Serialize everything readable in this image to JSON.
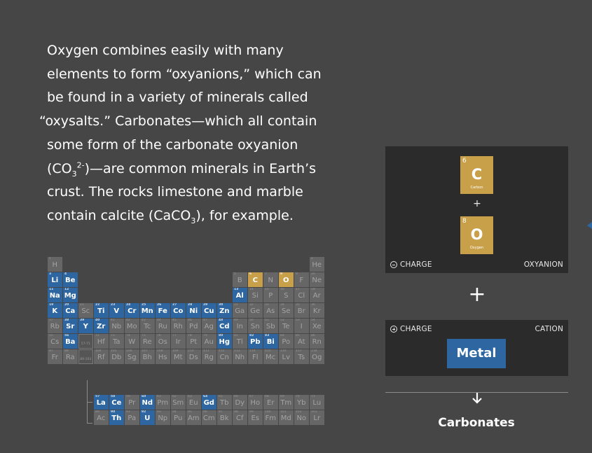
{
  "paragraph": {
    "l1": "Oxygen combines easily with many",
    "l2": "elements to form “oxyanions,” which can",
    "l3": "be found in a variety of minerals called",
    "l4": "“oxysalts.” Carbonates—which all contain",
    "l5": "some form of the carbonate oxyanion",
    "l6a": "(CO",
    "l6sub": "3",
    "l6sup": "2-",
    "l6b": ")—are common minerals in Earth’s",
    "l7": "crust. The rocks limestone and marble",
    "l8a": "contain calcite (CaCO",
    "l8sub": "3",
    "l8b": "), for example."
  },
  "periodic_table": {
    "elements": [
      {
        "n": 1,
        "s": "H",
        "r": 0,
        "c": 0,
        "t": "plain"
      },
      {
        "n": 2,
        "s": "He",
        "r": 0,
        "c": 17,
        "t": "plain"
      },
      {
        "n": 3,
        "s": "Li",
        "r": 1,
        "c": 0,
        "t": "high"
      },
      {
        "n": 4,
        "s": "Be",
        "r": 1,
        "c": 1,
        "t": "high"
      },
      {
        "n": 5,
        "s": "B",
        "r": 1,
        "c": 12,
        "t": "plain"
      },
      {
        "n": 6,
        "s": "C",
        "r": 1,
        "c": 13,
        "t": "gold"
      },
      {
        "n": 7,
        "s": "N",
        "r": 1,
        "c": 14,
        "t": "plain"
      },
      {
        "n": 8,
        "s": "O",
        "r": 1,
        "c": 15,
        "t": "gold"
      },
      {
        "n": 9,
        "s": "F",
        "r": 1,
        "c": 16,
        "t": "plain"
      },
      {
        "n": 10,
        "s": "Ne",
        "r": 1,
        "c": 17,
        "t": "plain"
      },
      {
        "n": 11,
        "s": "Na",
        "r": 2,
        "c": 0,
        "t": "high"
      },
      {
        "n": 12,
        "s": "Mg",
        "r": 2,
        "c": 1,
        "t": "high"
      },
      {
        "n": 13,
        "s": "Al",
        "r": 2,
        "c": 12,
        "t": "high"
      },
      {
        "n": 14,
        "s": "Si",
        "r": 2,
        "c": 13,
        "t": "plain"
      },
      {
        "n": 15,
        "s": "P",
        "r": 2,
        "c": 14,
        "t": "plain"
      },
      {
        "n": 16,
        "s": "S",
        "r": 2,
        "c": 15,
        "t": "plain"
      },
      {
        "n": 17,
        "s": "Cl",
        "r": 2,
        "c": 16,
        "t": "plain"
      },
      {
        "n": 18,
        "s": "Ar",
        "r": 2,
        "c": 17,
        "t": "plain"
      },
      {
        "n": 19,
        "s": "K",
        "r": 3,
        "c": 0,
        "t": "high"
      },
      {
        "n": 20,
        "s": "Ca",
        "r": 3,
        "c": 1,
        "t": "high"
      },
      {
        "n": 21,
        "s": "Sc",
        "r": 3,
        "c": 2,
        "t": "plain"
      },
      {
        "n": 22,
        "s": "Ti",
        "r": 3,
        "c": 3,
        "t": "high"
      },
      {
        "n": 23,
        "s": "V",
        "r": 3,
        "c": 4,
        "t": "high"
      },
      {
        "n": 24,
        "s": "Cr",
        "r": 3,
        "c": 5,
        "t": "high"
      },
      {
        "n": 25,
        "s": "Mn",
        "r": 3,
        "c": 6,
        "t": "high"
      },
      {
        "n": 26,
        "s": "Fe",
        "r": 3,
        "c": 7,
        "t": "high"
      },
      {
        "n": 27,
        "s": "Co",
        "r": 3,
        "c": 8,
        "t": "high"
      },
      {
        "n": 28,
        "s": "Ni",
        "r": 3,
        "c": 9,
        "t": "high"
      },
      {
        "n": 29,
        "s": "Cu",
        "r": 3,
        "c": 10,
        "t": "high"
      },
      {
        "n": 30,
        "s": "Zn",
        "r": 3,
        "c": 11,
        "t": "high"
      },
      {
        "n": 31,
        "s": "Ga",
        "r": 3,
        "c": 12,
        "t": "plain"
      },
      {
        "n": 32,
        "s": "Ge",
        "r": 3,
        "c": 13,
        "t": "plain"
      },
      {
        "n": 33,
        "s": "As",
        "r": 3,
        "c": 14,
        "t": "plain"
      },
      {
        "n": 34,
        "s": "Se",
        "r": 3,
        "c": 15,
        "t": "plain"
      },
      {
        "n": 35,
        "s": "Br",
        "r": 3,
        "c": 16,
        "t": "plain"
      },
      {
        "n": 36,
        "s": "Kr",
        "r": 3,
        "c": 17,
        "t": "plain"
      },
      {
        "n": 37,
        "s": "Rb",
        "r": 4,
        "c": 0,
        "t": "plain"
      },
      {
        "n": 38,
        "s": "Sr",
        "r": 4,
        "c": 1,
        "t": "high"
      },
      {
        "n": 39,
        "s": "Y",
        "r": 4,
        "c": 2,
        "t": "high"
      },
      {
        "n": 40,
        "s": "Zr",
        "r": 4,
        "c": 3,
        "t": "high"
      },
      {
        "n": 41,
        "s": "Nb",
        "r": 4,
        "c": 4,
        "t": "plain"
      },
      {
        "n": 42,
        "s": "Mo",
        "r": 4,
        "c": 5,
        "t": "plain"
      },
      {
        "n": 43,
        "s": "Tc",
        "r": 4,
        "c": 6,
        "t": "plain"
      },
      {
        "n": 44,
        "s": "Ru",
        "r": 4,
        "c": 7,
        "t": "plain"
      },
      {
        "n": 45,
        "s": "Rh",
        "r": 4,
        "c": 8,
        "t": "plain"
      },
      {
        "n": 46,
        "s": "Pd",
        "r": 4,
        "c": 9,
        "t": "plain"
      },
      {
        "n": 47,
        "s": "Ag",
        "r": 4,
        "c": 10,
        "t": "plain"
      },
      {
        "n": 48,
        "s": "Cd",
        "r": 4,
        "c": 11,
        "t": "high"
      },
      {
        "n": 49,
        "s": "In",
        "r": 4,
        "c": 12,
        "t": "plain"
      },
      {
        "n": 50,
        "s": "Sn",
        "r": 4,
        "c": 13,
        "t": "plain"
      },
      {
        "n": 51,
        "s": "Sb",
        "r": 4,
        "c": 14,
        "t": "plain"
      },
      {
        "n": 52,
        "s": "Te",
        "r": 4,
        "c": 15,
        "t": "plain"
      },
      {
        "n": 53,
        "s": "I",
        "r": 4,
        "c": 16,
        "t": "plain"
      },
      {
        "n": 54,
        "s": "Xe",
        "r": 4,
        "c": 17,
        "t": "plain"
      },
      {
        "n": 55,
        "s": "Cs",
        "r": 5,
        "c": 0,
        "t": "plain"
      },
      {
        "n": 56,
        "s": "Ba",
        "r": 5,
        "c": 1,
        "t": "high"
      },
      {
        "n": "",
        "s": "57-71",
        "r": 5,
        "c": 2,
        "t": "ph"
      },
      {
        "n": 72,
        "s": "Hf",
        "r": 5,
        "c": 3,
        "t": "plain"
      },
      {
        "n": 73,
        "s": "Ta",
        "r": 5,
        "c": 4,
        "t": "plain"
      },
      {
        "n": 74,
        "s": "W",
        "r": 5,
        "c": 5,
        "t": "plain"
      },
      {
        "n": 75,
        "s": "Re",
        "r": 5,
        "c": 6,
        "t": "plain"
      },
      {
        "n": 76,
        "s": "Os",
        "r": 5,
        "c": 7,
        "t": "plain"
      },
      {
        "n": 77,
        "s": "Ir",
        "r": 5,
        "c": 8,
        "t": "plain"
      },
      {
        "n": 78,
        "s": "Pt",
        "r": 5,
        "c": 9,
        "t": "plain"
      },
      {
        "n": 79,
        "s": "Au",
        "r": 5,
        "c": 10,
        "t": "plain"
      },
      {
        "n": 80,
        "s": "Hg",
        "r": 5,
        "c": 11,
        "t": "high"
      },
      {
        "n": 81,
        "s": "Tl",
        "r": 5,
        "c": 12,
        "t": "plain"
      },
      {
        "n": 82,
        "s": "Pb",
        "r": 5,
        "c": 13,
        "t": "high"
      },
      {
        "n": 83,
        "s": "Bi",
        "r": 5,
        "c": 14,
        "t": "high"
      },
      {
        "n": 84,
        "s": "Po",
        "r": 5,
        "c": 15,
        "t": "plain"
      },
      {
        "n": 85,
        "s": "At",
        "r": 5,
        "c": 16,
        "t": "plain"
      },
      {
        "n": 86,
        "s": "Rn",
        "r": 5,
        "c": 17,
        "t": "plain"
      },
      {
        "n": 87,
        "s": "Fr",
        "r": 6,
        "c": 0,
        "t": "plain"
      },
      {
        "n": 88,
        "s": "Ra",
        "r": 6,
        "c": 1,
        "t": "plain"
      },
      {
        "n": "",
        "s": "89-103",
        "r": 6,
        "c": 2,
        "t": "ph"
      },
      {
        "n": 104,
        "s": "Rf",
        "r": 6,
        "c": 3,
        "t": "plain"
      },
      {
        "n": 105,
        "s": "Db",
        "r": 6,
        "c": 4,
        "t": "plain"
      },
      {
        "n": 106,
        "s": "Sg",
        "r": 6,
        "c": 5,
        "t": "plain"
      },
      {
        "n": 107,
        "s": "Bh",
        "r": 6,
        "c": 6,
        "t": "plain"
      },
      {
        "n": 108,
        "s": "Hs",
        "r": 6,
        "c": 7,
        "t": "plain"
      },
      {
        "n": 109,
        "s": "Mt",
        "r": 6,
        "c": 8,
        "t": "plain"
      },
      {
        "n": 110,
        "s": "Ds",
        "r": 6,
        "c": 9,
        "t": "plain"
      },
      {
        "n": 111,
        "s": "Rg",
        "r": 6,
        "c": 10,
        "t": "plain"
      },
      {
        "n": 112,
        "s": "Cn",
        "r": 6,
        "c": 11,
        "t": "plain"
      },
      {
        "n": 113,
        "s": "Nh",
        "r": 6,
        "c": 12,
        "t": "plain"
      },
      {
        "n": 114,
        "s": "Fl",
        "r": 6,
        "c": 13,
        "t": "plain"
      },
      {
        "n": 115,
        "s": "Mc",
        "r": 6,
        "c": 14,
        "t": "plain"
      },
      {
        "n": 116,
        "s": "Lv",
        "r": 6,
        "c": 15,
        "t": "plain"
      },
      {
        "n": 117,
        "s": "Ts",
        "r": 6,
        "c": 16,
        "t": "plain"
      },
      {
        "n": 118,
        "s": "Og",
        "r": 6,
        "c": 17,
        "t": "plain"
      },
      {
        "n": 57,
        "s": "La",
        "r": 7,
        "c": 3,
        "t": "high"
      },
      {
        "n": 58,
        "s": "Ce",
        "r": 7,
        "c": 4,
        "t": "high"
      },
      {
        "n": 59,
        "s": "Pr",
        "r": 7,
        "c": 5,
        "t": "plain"
      },
      {
        "n": 60,
        "s": "Nd",
        "r": 7,
        "c": 6,
        "t": "high"
      },
      {
        "n": 61,
        "s": "Pm",
        "r": 7,
        "c": 7,
        "t": "plain"
      },
      {
        "n": 62,
        "s": "Sm",
        "r": 7,
        "c": 8,
        "t": "plain"
      },
      {
        "n": 63,
        "s": "Eu",
        "r": 7,
        "c": 9,
        "t": "plain"
      },
      {
        "n": 64,
        "s": "Gd",
        "r": 7,
        "c": 10,
        "t": "high"
      },
      {
        "n": 65,
        "s": "Tb",
        "r": 7,
        "c": 11,
        "t": "plain"
      },
      {
        "n": 66,
        "s": "Dy",
        "r": 7,
        "c": 12,
        "t": "plain"
      },
      {
        "n": 67,
        "s": "Ho",
        "r": 7,
        "c": 13,
        "t": "plain"
      },
      {
        "n": 68,
        "s": "Er",
        "r": 7,
        "c": 14,
        "t": "plain"
      },
      {
        "n": 69,
        "s": "Tm",
        "r": 7,
        "c": 15,
        "t": "plain"
      },
      {
        "n": 70,
        "s": "Yb",
        "r": 7,
        "c": 16,
        "t": "plain"
      },
      {
        "n": 71,
        "s": "Lu",
        "r": 7,
        "c": 17,
        "t": "plain"
      },
      {
        "n": 89,
        "s": "Ac",
        "r": 8,
        "c": 3,
        "t": "plain"
      },
      {
        "n": 90,
        "s": "Th",
        "r": 8,
        "c": 4,
        "t": "high"
      },
      {
        "n": 91,
        "s": "Pa",
        "r": 8,
        "c": 5,
        "t": "plain"
      },
      {
        "n": 92,
        "s": "U",
        "r": 8,
        "c": 6,
        "t": "high"
      },
      {
        "n": 93,
        "s": "Np",
        "r": 8,
        "c": 7,
        "t": "plain"
      },
      {
        "n": 94,
        "s": "Pu",
        "r": 8,
        "c": 8,
        "t": "plain"
      },
      {
        "n": 95,
        "s": "Am",
        "r": 8,
        "c": 9,
        "t": "plain"
      },
      {
        "n": 96,
        "s": "Cm",
        "r": 8,
        "c": 10,
        "t": "plain"
      },
      {
        "n": 97,
        "s": "Bk",
        "r": 8,
        "c": 11,
        "t": "plain"
      },
      {
        "n": 98,
        "s": "Cf",
        "r": 8,
        "c": 12,
        "t": "plain"
      },
      {
        "n": 99,
        "s": "Es",
        "r": 8,
        "c": 13,
        "t": "plain"
      },
      {
        "n": 100,
        "s": "Fm",
        "r": 8,
        "c": 14,
        "t": "plain"
      },
      {
        "n": 101,
        "s": "Md",
        "r": 8,
        "c": 15,
        "t": "plain"
      },
      {
        "n": 102,
        "s": "No",
        "r": 8,
        "c": 16,
        "t": "plain"
      },
      {
        "n": 103,
        "s": "Lr",
        "r": 8,
        "c": 17,
        "t": "plain"
      }
    ]
  },
  "oxyanion_panel": {
    "carbon": {
      "number": "6",
      "symbol": "C",
      "name": "Carbon"
    },
    "plus": "+",
    "oxygen": {
      "number": "8",
      "symbol": "O",
      "name": "Oxygen"
    },
    "charge_label": "CHARGE",
    "type_label": "OXYANION"
  },
  "big_plus": "+",
  "cation_panel": {
    "charge_label": "CHARGE",
    "type_label": "CATION",
    "metal_label": "Metal"
  },
  "result_label": "Carbonates",
  "colors": {
    "background": "#464646",
    "panel": "#2b2b2b",
    "highlight_blue": "#2d66a0",
    "highlight_gold": "#c9a04a",
    "element_plain": "#666666"
  },
  "icons": [
    "minus-circle-icon",
    "plus-circle-icon",
    "down-arrow-icon"
  ]
}
